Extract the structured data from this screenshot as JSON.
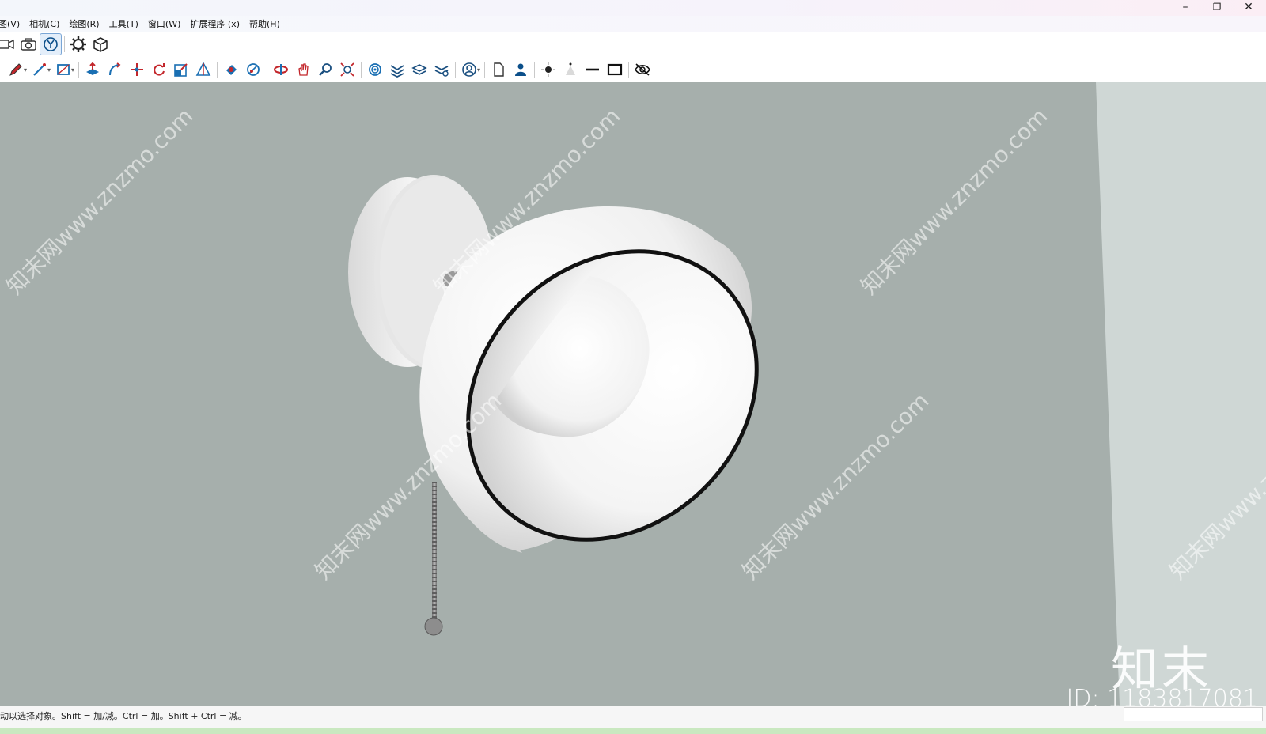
{
  "window": {
    "minimize_glyph": "–",
    "restore_glyph": "❐",
    "close_glyph": "✕"
  },
  "menu": {
    "items": [
      "图(V)",
      "相机(C)",
      "绘图(R)",
      "工具(T)",
      "窗口(W)",
      "扩展程序 (x)",
      "帮助(H)"
    ]
  },
  "toolbar_top": {
    "icons": [
      "video-camera-icon",
      "camera-icon",
      "orbit-y-icon",
      "component-gear-icon",
      "package-box-icon"
    ]
  },
  "toolbar_main": {
    "icons": [
      "pencil-icon",
      "line-tool-icon",
      "rectangle-tool-icon",
      "push-pull-icon",
      "follow-me-icon",
      "move-icon",
      "rotate-icon",
      "scale-icon",
      "section-plane-icon",
      "paint-bucket-icon",
      "sample-icon",
      "orbit-icon",
      "pan-icon",
      "zoom-icon",
      "zoom-extents-icon",
      "target-icon",
      "layers-icon",
      "layer-stack-icon",
      "layer-settings-icon",
      "user-circle-icon",
      "document-icon",
      "person-icon",
      "sun-icon",
      "cone-icon",
      "line-weight-icon",
      "frame-icon",
      "hide-eye-icon"
    ]
  },
  "viewport": {
    "background": "#a6afac",
    "side_panel_color": "#cfd7d5",
    "watermarks": [
      "知末网www.znzmo.com"
    ]
  },
  "statusbar": {
    "text": "动以选择对象。Shift = 加/减。Ctrl = 加。Shift + Ctrl = 减。"
  },
  "brand": {
    "logo_text": "知末",
    "id_text": "ID: 1183817081"
  }
}
